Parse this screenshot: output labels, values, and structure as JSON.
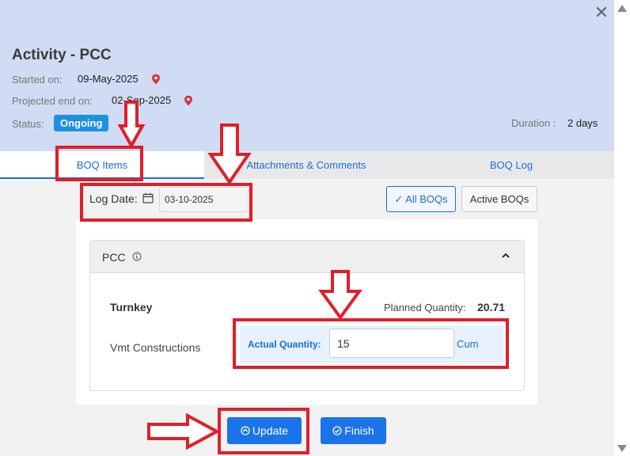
{
  "header": {
    "title": "Activity - PCC",
    "started_label": "Started on:",
    "started_value": "09-May-2025",
    "projected_label": "Projected end on:",
    "projected_value": "02-Sep-2025",
    "status_label": "Status:",
    "status_value": "Ongoing",
    "duration_label": "Duration :",
    "duration_value": "2 days",
    "close_symbol": "✕"
  },
  "tabs": [
    {
      "label": "BOQ Items",
      "active": true
    },
    {
      "label": "Attachments & Comments",
      "active": false
    },
    {
      "label": "BOQ Log",
      "active": false
    }
  ],
  "log": {
    "label": "Log Date:",
    "date_value": "03-10-2025"
  },
  "filters": {
    "all_label": "✓ All BOQs",
    "active_label": "Active BOQs"
  },
  "accordion": {
    "title": "PCC",
    "item_name": "Turnkey",
    "planned_label": "Planned Quantity:",
    "planned_value": "20.71",
    "vendor": "Vmt Constructions",
    "actual_label": "Actual Quantity:",
    "actual_value": "15",
    "unit": "Cum"
  },
  "actions": {
    "update_label": "Update",
    "finish_label": "Finish"
  },
  "colors": {
    "header_bg": "#cfdcf3",
    "accent": "#1a73e8",
    "status_badge": "#1e90e0",
    "annotation": "#e01e2a",
    "pin": "#d9363e"
  }
}
